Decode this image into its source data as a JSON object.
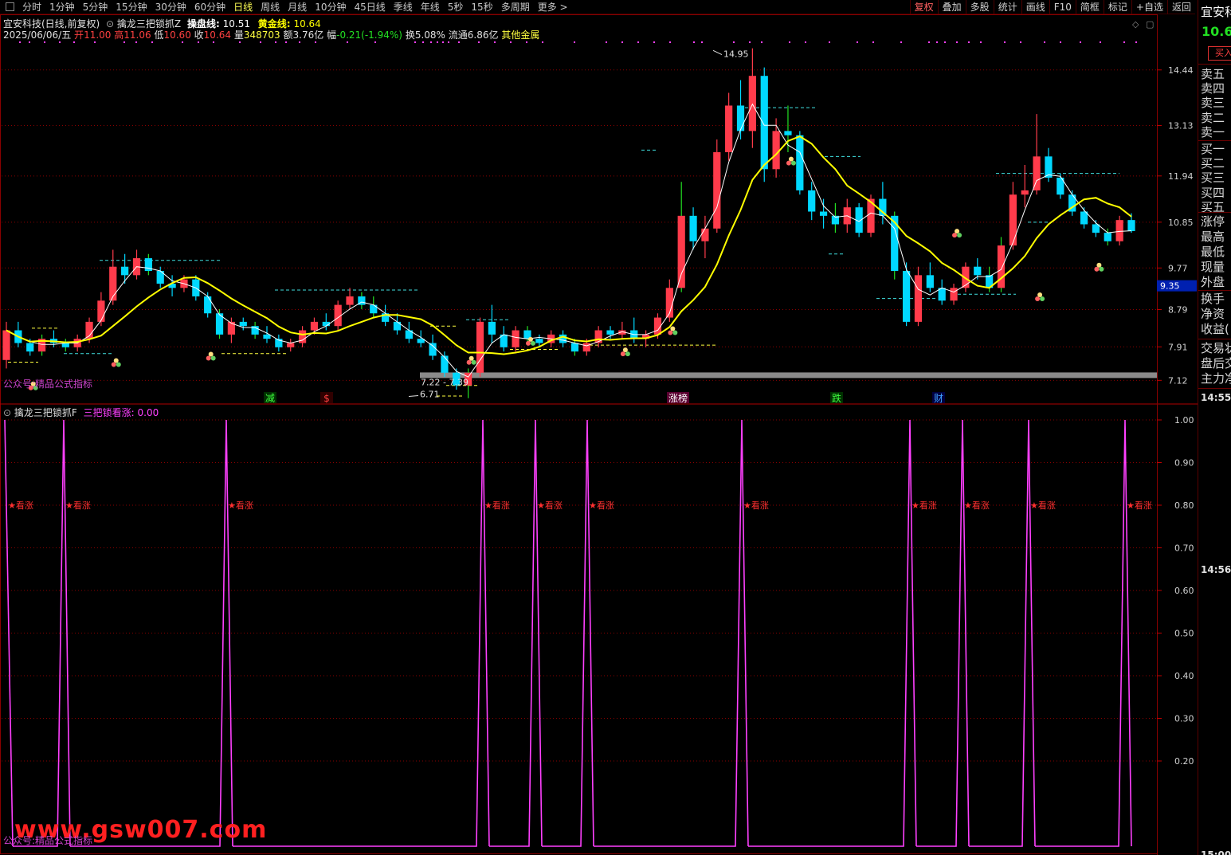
{
  "toolbar": {
    "periods": [
      "分时",
      "1分钟",
      "5分钟",
      "15分钟",
      "30分钟",
      "60分钟",
      "日线",
      "周线",
      "月线",
      "10分钟",
      "45日线",
      "季线",
      "年线",
      "5秒",
      "15秒",
      "多周期",
      "更多 >"
    ],
    "active_period": "日线",
    "right_tools": [
      "复权",
      "叠加",
      "多股",
      "统计",
      "画线",
      "F10",
      "简框",
      "标记",
      "+自选",
      "返回"
    ]
  },
  "header": {
    "stock": "宜安科技(日线,前复权)",
    "indicator_name": "擒龙三把锁抓Z",
    "line1_label": "操盘线:",
    "line1_value": "10.51",
    "line2_label": "黄金线:",
    "line2_value": "10.64"
  },
  "quote": {
    "date": "2025/06/06/五",
    "open_label": "开",
    "open": "11.00",
    "high_label": "高",
    "high": "11.06",
    "low_label": "低",
    "low": "10.60",
    "close_label": "收",
    "close": "10.64",
    "volume_label": "量",
    "volume": "348703",
    "amount_label": "额",
    "amount": "3.76亿",
    "change_label": "幅",
    "change": "-0.21(-1.94%)",
    "turnover_label": "换",
    "turnover": "5.08%",
    "float_label": "流通",
    "float": "6.86亿",
    "sector": "其他金属"
  },
  "price_axis": {
    "ticks": [
      "14.44",
      "13.13",
      "11.94",
      "10.85",
      "9.77",
      "8.79",
      "7.91",
      "7.12"
    ],
    "current_marker": "9.35"
  },
  "annotations": {
    "high_label": "14.95",
    "low_label": "6.71",
    "range_label": "7.22 - 7.39",
    "event_tags": [
      "减",
      "$",
      "涨榜",
      "跌",
      "财"
    ]
  },
  "lower_panel": {
    "indicator_name": "擒龙三把锁抓F",
    "series_label": "三把锁看涨:",
    "series_value": "0.00",
    "signal_text": "★看涨",
    "axis_ticks": [
      "1.00",
      "0.90",
      "0.80",
      "0.70",
      "0.60",
      "0.50",
      "0.40",
      "0.30",
      "0.20"
    ]
  },
  "footer": {
    "promo": "公众号:精品公式指标",
    "watermark": "www.gsw007.com"
  },
  "right_panel": {
    "name": "宜安科",
    "price": "10.6",
    "buy_button": "买入",
    "order_book": [
      "卖五",
      "卖四",
      "卖三",
      "卖二",
      "卖一",
      "买一",
      "买二",
      "买三",
      "买四",
      "买五"
    ],
    "stats": [
      "涨停",
      "最高",
      "最低",
      "现量",
      "外盘"
    ],
    "stats2": [
      "换手",
      "净资",
      "收益("
    ],
    "extra": [
      "交易状",
      "盘后交",
      "主力净"
    ],
    "times": [
      "14:55",
      "14:56",
      "15:00"
    ]
  },
  "colors": {
    "up": "#ff3b4b",
    "down": "#00d8ff",
    "ma_white": "#ffffff",
    "ma_yellow": "#ffff00",
    "signal_line": "#ff40ff",
    "dashed": "#40e0e0",
    "grid": "#8a0000"
  },
  "chart_data": {
    "type": "candlestick",
    "price_range": [
      6.6,
      15.3
    ],
    "candles": [
      [
        7.6,
        8.5,
        7.4,
        8.3
      ],
      [
        8.3,
        8.5,
        7.9,
        8.0
      ],
      [
        8.0,
        8.1,
        7.7,
        7.8
      ],
      [
        7.8,
        8.2,
        7.7,
        8.1
      ],
      [
        8.1,
        8.3,
        7.9,
        8.0
      ],
      [
        8.0,
        8.1,
        7.8,
        7.9
      ],
      [
        7.9,
        8.2,
        7.8,
        8.1
      ],
      [
        8.1,
        8.6,
        8.0,
        8.5
      ],
      [
        8.5,
        9.2,
        8.4,
        9.0
      ],
      [
        9.0,
        10.2,
        8.9,
        9.8
      ],
      [
        9.8,
        10.1,
        9.4,
        9.6
      ],
      [
        9.6,
        10.2,
        9.5,
        10.0
      ],
      [
        10.0,
        10.1,
        9.6,
        9.7
      ],
      [
        9.7,
        9.8,
        9.3,
        9.4
      ],
      [
        9.4,
        9.6,
        9.1,
        9.3
      ],
      [
        9.3,
        9.6,
        9.2,
        9.5
      ],
      [
        9.5,
        9.6,
        9.0,
        9.1
      ],
      [
        9.1,
        9.2,
        8.6,
        8.7
      ],
      [
        8.7,
        8.8,
        8.1,
        8.2
      ],
      [
        8.2,
        8.6,
        8.0,
        8.5
      ],
      [
        8.5,
        8.6,
        8.3,
        8.4
      ],
      [
        8.4,
        8.5,
        8.1,
        8.2
      ],
      [
        8.2,
        8.4,
        8.0,
        8.1
      ],
      [
        8.1,
        8.2,
        7.8,
        7.9
      ],
      [
        7.9,
        8.1,
        7.8,
        8.0
      ],
      [
        8.0,
        8.4,
        7.9,
        8.3
      ],
      [
        8.3,
        8.6,
        8.2,
        8.5
      ],
      [
        8.5,
        8.7,
        8.3,
        8.4
      ],
      [
        8.4,
        9.0,
        8.3,
        8.9
      ],
      [
        8.9,
        9.3,
        8.8,
        9.1
      ],
      [
        9.1,
        9.2,
        8.8,
        8.9
      ],
      [
        8.9,
        9.1,
        8.6,
        8.7
      ],
      [
        8.7,
        8.9,
        8.4,
        8.5
      ],
      [
        8.5,
        8.7,
        8.2,
        8.3
      ],
      [
        8.3,
        8.5,
        8.0,
        8.1
      ],
      [
        8.1,
        8.3,
        7.9,
        8.0
      ],
      [
        8.0,
        8.2,
        7.6,
        7.7
      ],
      [
        7.7,
        7.8,
        7.2,
        7.3
      ],
      [
        7.3,
        7.4,
        6.9,
        7.0
      ],
      [
        7.0,
        7.4,
        6.7,
        7.3
      ],
      [
        7.3,
        8.6,
        7.2,
        8.5
      ],
      [
        8.5,
        8.9,
        8.0,
        8.2
      ],
      [
        8.2,
        8.4,
        7.8,
        7.9
      ],
      [
        7.9,
        8.4,
        7.8,
        8.3
      ],
      [
        8.3,
        8.4,
        8.0,
        8.1
      ],
      [
        8.1,
        8.2,
        7.9,
        8.0
      ],
      [
        8.0,
        8.3,
        7.9,
        8.2
      ],
      [
        8.2,
        8.3,
        7.9,
        8.0
      ],
      [
        8.0,
        8.1,
        7.7,
        7.8
      ],
      [
        7.8,
        8.1,
        7.7,
        8.0
      ],
      [
        8.0,
        8.4,
        7.9,
        8.3
      ],
      [
        8.3,
        8.4,
        8.1,
        8.2
      ],
      [
        8.2,
        8.5,
        8.1,
        8.3
      ],
      [
        8.3,
        8.6,
        8.0,
        8.1
      ],
      [
        8.1,
        8.3,
        7.9,
        8.2
      ],
      [
        8.2,
        8.7,
        8.1,
        8.6
      ],
      [
        8.6,
        9.5,
        8.5,
        9.3
      ],
      [
        9.3,
        11.8,
        9.2,
        11.0
      ],
      [
        11.0,
        11.2,
        10.2,
        10.4
      ],
      [
        10.4,
        11.0,
        10.0,
        10.7
      ],
      [
        10.7,
        12.8,
        10.6,
        12.5
      ],
      [
        12.5,
        13.9,
        12.3,
        13.6
      ],
      [
        13.6,
        14.2,
        12.8,
        13.0
      ],
      [
        13.0,
        14.95,
        12.6,
        14.3
      ],
      [
        14.3,
        14.5,
        11.8,
        12.1
      ],
      [
        12.1,
        13.3,
        11.9,
        13.0
      ],
      [
        13.0,
        13.6,
        12.5,
        12.9
      ],
      [
        12.9,
        13.0,
        11.5,
        11.6
      ],
      [
        11.6,
        11.8,
        10.9,
        11.1
      ],
      [
        11.1,
        11.4,
        10.7,
        11.0
      ],
      [
        11.0,
        11.3,
        10.6,
        10.8
      ],
      [
        10.8,
        11.4,
        10.6,
        11.2
      ],
      [
        11.2,
        11.3,
        10.5,
        10.6
      ],
      [
        10.6,
        11.5,
        10.5,
        11.4
      ],
      [
        11.4,
        11.8,
        10.8,
        11.0
      ],
      [
        11.0,
        11.1,
        9.5,
        9.7
      ],
      [
        9.7,
        9.9,
        8.4,
        8.5
      ],
      [
        8.5,
        9.8,
        8.4,
        9.6
      ],
      [
        9.6,
        9.9,
        9.2,
        9.3
      ],
      [
        9.3,
        9.5,
        8.9,
        9.0
      ],
      [
        9.0,
        9.4,
        8.9,
        9.3
      ],
      [
        9.3,
        9.9,
        9.2,
        9.8
      ],
      [
        9.8,
        10.0,
        9.5,
        9.6
      ],
      [
        9.6,
        9.8,
        9.2,
        9.3
      ],
      [
        9.3,
        10.5,
        9.2,
        10.3
      ],
      [
        10.3,
        11.8,
        10.2,
        11.5
      ],
      [
        11.5,
        12.2,
        11.2,
        11.6
      ],
      [
        11.6,
        13.4,
        11.5,
        12.4
      ],
      [
        12.4,
        12.6,
        11.8,
        11.9
      ],
      [
        11.9,
        12.0,
        11.4,
        11.5
      ],
      [
        11.5,
        11.6,
        11.0,
        11.1
      ],
      [
        11.1,
        11.2,
        10.7,
        10.8
      ],
      [
        10.8,
        10.9,
        10.5,
        10.6
      ],
      [
        10.6,
        10.7,
        10.3,
        10.4
      ],
      [
        10.4,
        11.0,
        10.3,
        10.9
      ],
      [
        10.9,
        11.06,
        10.6,
        10.64
      ]
    ],
    "signals": [
      2,
      9,
      34,
      80,
      87,
      92,
      120,
      140,
      149,
      158,
      168
    ]
  }
}
